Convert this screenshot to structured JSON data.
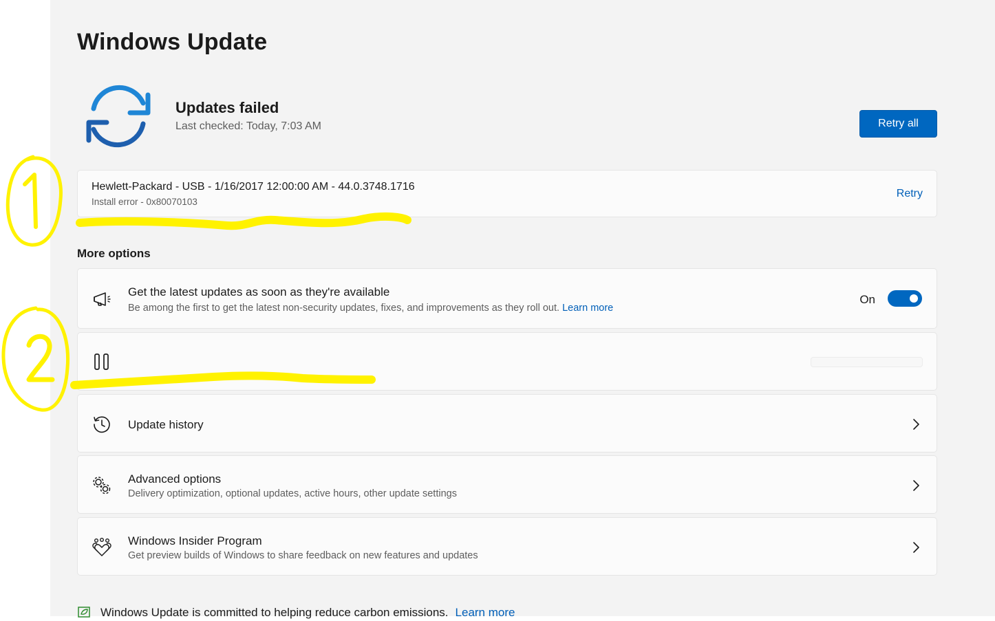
{
  "page": {
    "title": "Windows Update"
  },
  "status": {
    "icon": "sync-icon",
    "title": "Updates failed",
    "subtitle": "Last checked: Today, 7:03 AM",
    "retry_all_label": "Retry all"
  },
  "failed_update": {
    "title": "Hewlett-Packard - USB - 1/16/2017 12:00:00 AM - 44.0.3748.1716",
    "error": "Install error - 0x80070103",
    "retry_label": "Retry"
  },
  "more_options": {
    "label": "More options",
    "latest_updates": {
      "icon": "megaphone-icon",
      "title": "Get the latest updates as soon as they're available",
      "subtitle": "Be among the first to get the latest non-security updates, fixes, and improvements as they roll out.",
      "link": "Learn more",
      "toggle_label": "On",
      "toggle_on": true
    },
    "pause": {
      "icon": "pause-icon"
    },
    "history": {
      "icon": "history-icon",
      "title": "Update history"
    },
    "advanced": {
      "icon": "gears-icon",
      "title": "Advanced options",
      "subtitle": "Delivery optimization, optional updates, active hours, other update settings"
    },
    "insider": {
      "icon": "insider-hearts-icon",
      "title": "Windows Insider Program",
      "subtitle": "Get preview builds of Windows to share feedback on new features and updates"
    }
  },
  "footer": {
    "icon": "leaf-icon",
    "text": "Windows Update is committed to helping reduce carbon emissions.",
    "link": "Learn more"
  },
  "annotations": {
    "label_1": "1",
    "label_2": "2",
    "color": "#fff200"
  },
  "colors": {
    "accent": "#0067c0",
    "link": "#005fb8",
    "icon_blue": "#1f86d6"
  }
}
